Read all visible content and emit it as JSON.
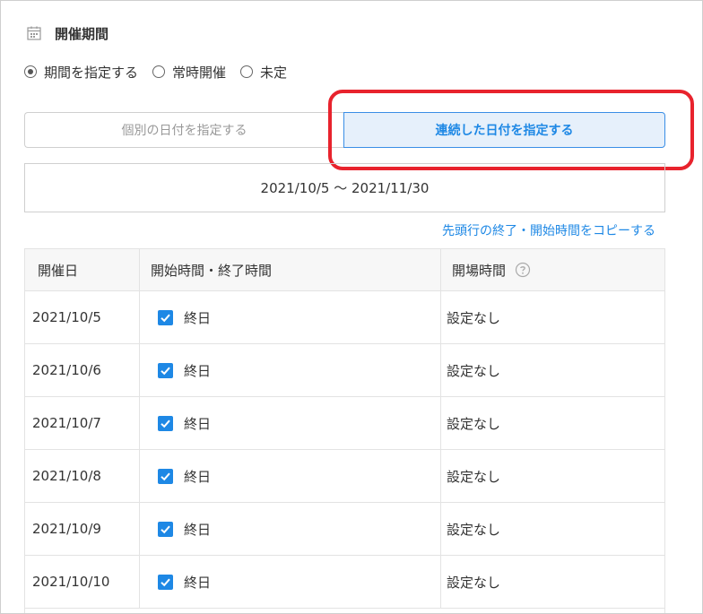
{
  "section": {
    "title": "開催期間",
    "icon": "calendar-icon"
  },
  "period_options": [
    {
      "label": "期間を指定する",
      "checked": true
    },
    {
      "label": "常時開催",
      "checked": false
    },
    {
      "label": "未定",
      "checked": false
    }
  ],
  "date_mode": {
    "individual_label": "個別の日付を指定する",
    "consecutive_label": "連続した日付を指定する",
    "selected": "consecutive"
  },
  "date_range": "2021/10/5 〜 2021/11/30",
  "copy_link": "先頭行の終了・開始時間をコピーする",
  "table": {
    "headers": [
      "開催日",
      "開始時間・終了時間",
      "開場時間"
    ],
    "rows": [
      {
        "date": "2021/10/5",
        "all_day": true,
        "all_day_label": "終日",
        "open_time": "設定なし"
      },
      {
        "date": "2021/10/6",
        "all_day": true,
        "all_day_label": "終日",
        "open_time": "設定なし"
      },
      {
        "date": "2021/10/7",
        "all_day": true,
        "all_day_label": "終日",
        "open_time": "設定なし"
      },
      {
        "date": "2021/10/8",
        "all_day": true,
        "all_day_label": "終日",
        "open_time": "設定なし"
      },
      {
        "date": "2021/10/9",
        "all_day": true,
        "all_day_label": "終日",
        "open_time": "設定なし"
      },
      {
        "date": "2021/10/10",
        "all_day": true,
        "all_day_label": "終日",
        "open_time": "設定なし"
      }
    ]
  },
  "colors": {
    "accent": "#1e88e5",
    "highlight": "#e8232d",
    "selected_bg": "#e6f0fb"
  }
}
